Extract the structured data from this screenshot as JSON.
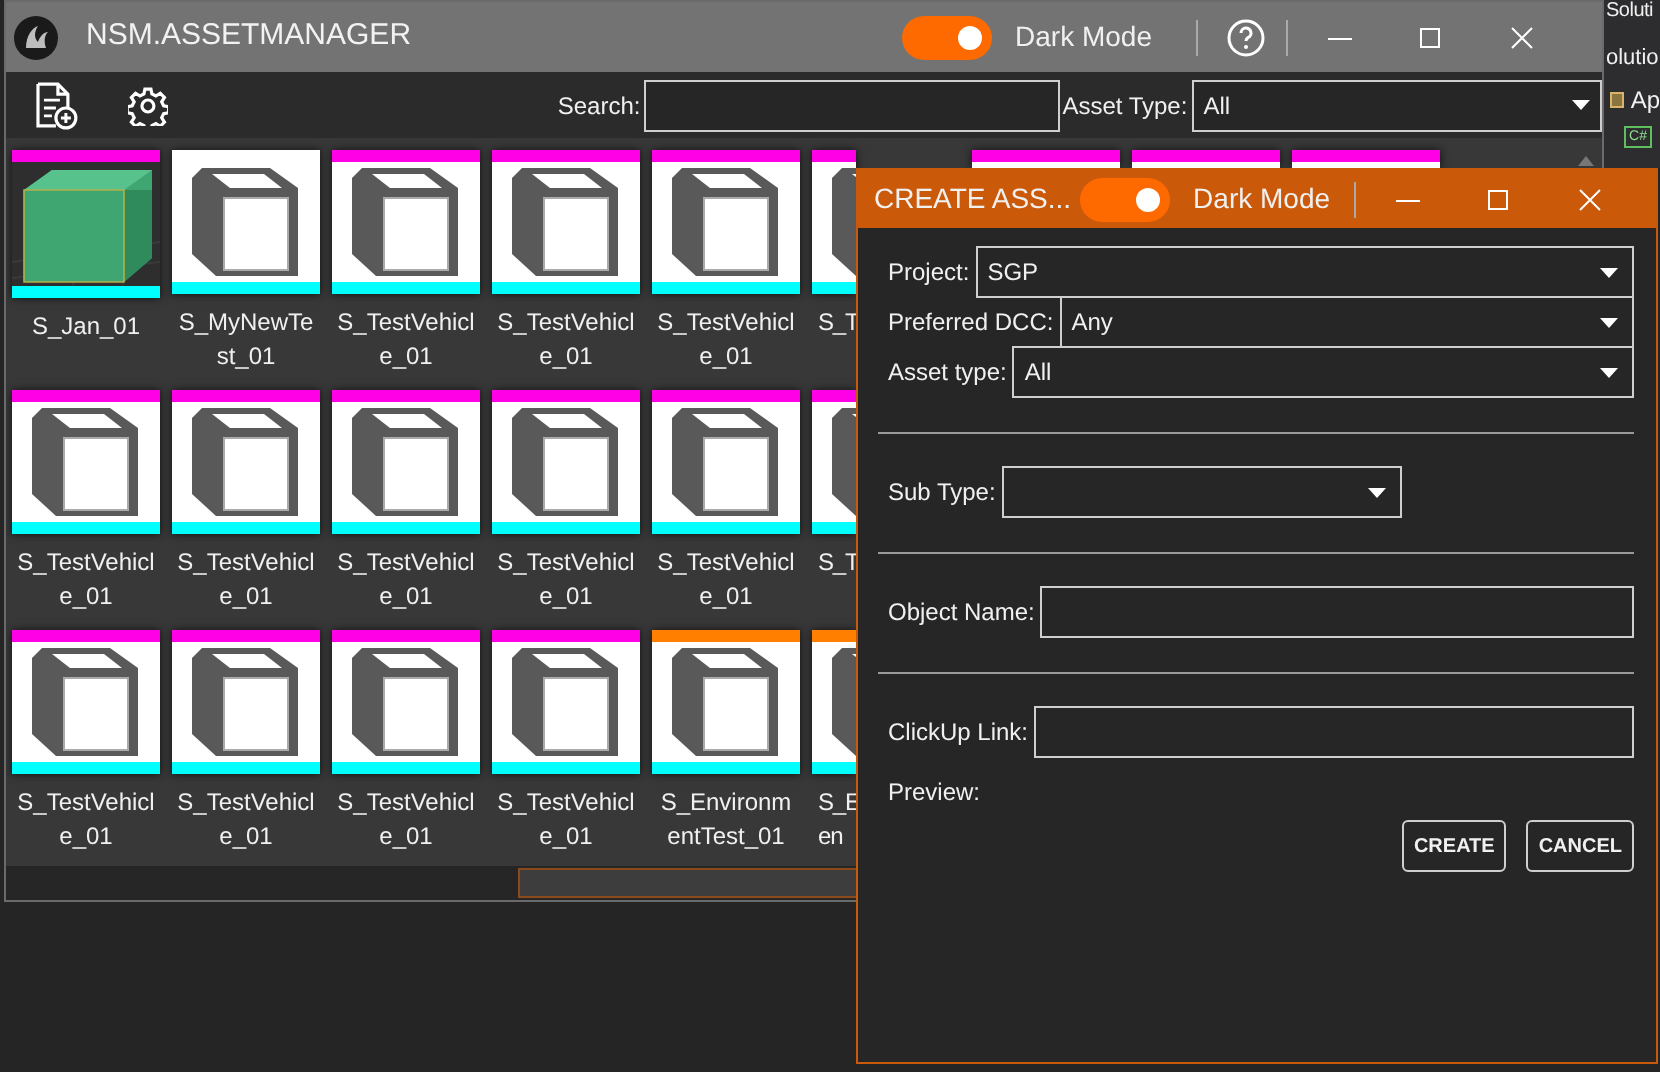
{
  "main_window": {
    "title": "NSM.ASSETMANAGER",
    "dark_mode": {
      "label": "Dark Mode",
      "on": true
    },
    "search": {
      "label": "Search:"
    },
    "asset_type": {
      "label": "Asset Type:",
      "value": "All"
    },
    "asset_rows": [
      [
        {
          "kind": "picture",
          "color": "#ff00e6",
          "lines": [
            "S_Jan_01"
          ]
        },
        {
          "kind": "cube",
          "lines": [
            "S_MyNewTe",
            "st_01"
          ]
        },
        {
          "kind": "cube",
          "color": "#ff00e6",
          "lines": [
            "S_TestVehicl",
            "e_01"
          ]
        },
        {
          "kind": "cube",
          "color": "#ff00e6",
          "lines": [
            "S_TestVehicl",
            "e_01"
          ]
        },
        {
          "kind": "cube",
          "color": "#ff00e6",
          "lines": [
            "S_TestVehicl",
            "e_01"
          ]
        },
        {
          "kind": "cut",
          "color": "#ff00e6",
          "lines": [
            "S_T"
          ]
        },
        {
          "kind": "edge",
          "color": "#ff00e6"
        },
        {
          "kind": "edge",
          "color": "#ff00e6"
        },
        {
          "kind": "edge",
          "color": "#ff00e6"
        }
      ],
      [
        {
          "kind": "cube",
          "color": "#ff00e6",
          "lines": [
            "S_TestVehicl",
            "e_01"
          ]
        },
        {
          "kind": "cube",
          "color": "#ff00e6",
          "lines": [
            "S_TestVehicl",
            "e_01"
          ]
        },
        {
          "kind": "cube",
          "color": "#ff00e6",
          "lines": [
            "S_TestVehicl",
            "e_01"
          ]
        },
        {
          "kind": "cube",
          "color": "#ff00e6",
          "lines": [
            "S_TestVehicl",
            "e_01"
          ]
        },
        {
          "kind": "cube",
          "color": "#ff00e6",
          "lines": [
            "S_TestVehicl",
            "e_01"
          ]
        },
        {
          "kind": "cut",
          "color": "#ff00e6",
          "lines": [
            "S_T"
          ]
        }
      ],
      [
        {
          "kind": "cube",
          "color": "#ff00e6",
          "lines": [
            "S_TestVehicl",
            "e_01"
          ]
        },
        {
          "kind": "cube",
          "color": "#ff00e6",
          "lines": [
            "S_TestVehicl",
            "e_01"
          ]
        },
        {
          "kind": "cube",
          "color": "#ff00e6",
          "lines": [
            "S_TestVehicl",
            "e_01"
          ]
        },
        {
          "kind": "cube",
          "color": "#ff00e6",
          "lines": [
            "S_TestVehicl",
            "e_01"
          ]
        },
        {
          "kind": "cube",
          "color": "#ff7f00",
          "lines": [
            "S_Environm",
            "entTest_01"
          ]
        },
        {
          "kind": "cut",
          "color": "#ff7f00",
          "lines": [
            "S_E",
            "en"
          ]
        }
      ]
    ]
  },
  "side_panel": {
    "texts": [
      "Soluti",
      "olutio",
      "Ap"
    ],
    "badge": "C#"
  },
  "dialog": {
    "title": "CREATE ASS...",
    "dark_mode": {
      "label": "Dark Mode",
      "on": true
    },
    "sections": [
      [
        {
          "kind": "combo",
          "label": "Project:",
          "value": "SGP"
        },
        {
          "kind": "combo",
          "label": "Preferred DCC:",
          "value": "Any"
        },
        {
          "kind": "combo",
          "label": "Asset type:",
          "value": "All"
        }
      ],
      [
        {
          "kind": "small_combo",
          "label": "Sub Type:"
        }
      ],
      [
        {
          "kind": "text",
          "label": "Object Name:"
        }
      ],
      [
        {
          "kind": "text",
          "label": "ClickUp Link:"
        }
      ]
    ],
    "preview_label": "Preview:",
    "buttons": [
      "CREATE",
      "CANCEL"
    ]
  }
}
